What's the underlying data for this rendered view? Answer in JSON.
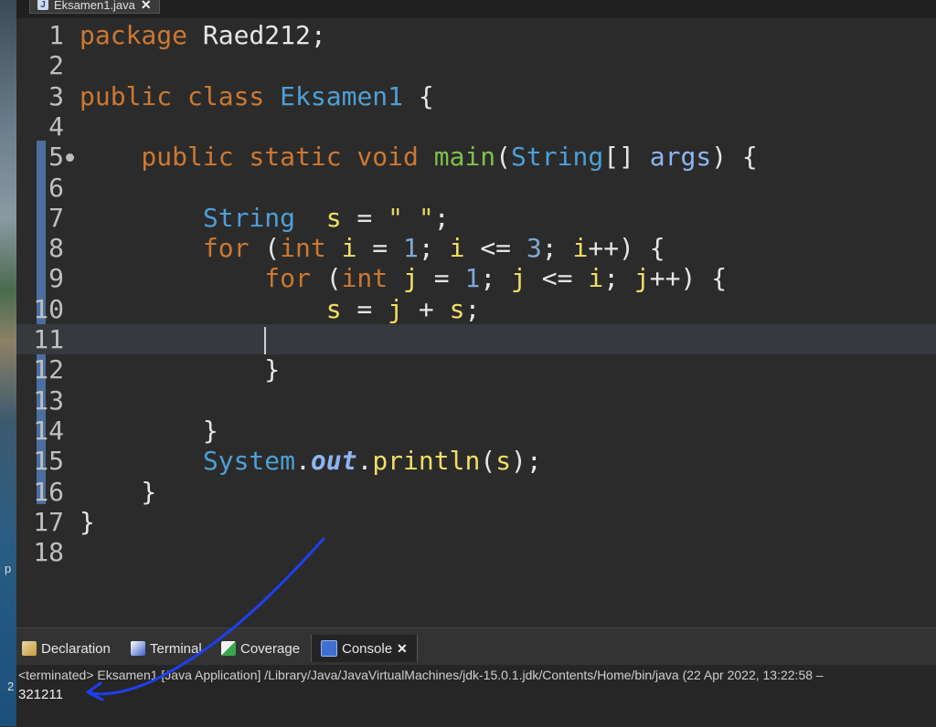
{
  "editor_tab": {
    "icon": "J",
    "title": "Eksamen1.java",
    "close": "✕"
  },
  "desktop": {
    "letter_p": "p",
    "digit_2": "2"
  },
  "code_lines": [
    {
      "n": "1",
      "tokens": [
        [
          "kw",
          "package "
        ],
        [
          "pn",
          "Raed212;"
        ]
      ]
    },
    {
      "n": "2",
      "tokens": []
    },
    {
      "n": "3",
      "tokens": [
        [
          "kw",
          "public class "
        ],
        [
          "ty",
          "Eksamen1"
        ],
        [
          "pn",
          " {"
        ]
      ]
    },
    {
      "n": "4",
      "tokens": []
    },
    {
      "n": "5",
      "tokens": [
        [
          "kw",
          "    public static void "
        ],
        [
          "mt",
          "main"
        ],
        [
          "pn",
          "("
        ],
        [
          "ty",
          "String"
        ],
        [
          "pn",
          "[] "
        ],
        [
          "pv",
          "args"
        ],
        [
          "pn",
          ") {"
        ]
      ],
      "marker": true
    },
    {
      "n": "6",
      "tokens": []
    },
    {
      "n": "7",
      "tokens": [
        [
          "ty",
          "        String  "
        ],
        [
          "vr",
          "s"
        ],
        [
          "pn",
          " = "
        ],
        [
          "st",
          "\" \""
        ],
        [
          "pn",
          ";"
        ]
      ]
    },
    {
      "n": "8",
      "tokens": [
        [
          "kw",
          "        for "
        ],
        [
          "pn",
          "("
        ],
        [
          "kw",
          "int "
        ],
        [
          "vr",
          "i"
        ],
        [
          "pn",
          " = "
        ],
        [
          "nm",
          "1"
        ],
        [
          "pn",
          "; "
        ],
        [
          "vr",
          "i"
        ],
        [
          "pn",
          " <= "
        ],
        [
          "nm",
          "3"
        ],
        [
          "pn",
          "; "
        ],
        [
          "vr",
          "i"
        ],
        [
          "pn",
          "++) {"
        ]
      ]
    },
    {
      "n": "9",
      "tokens": [
        [
          "kw",
          "            for "
        ],
        [
          "pn",
          "("
        ],
        [
          "kw",
          "int "
        ],
        [
          "vr",
          "j"
        ],
        [
          "pn",
          " = "
        ],
        [
          "nm",
          "1"
        ],
        [
          "pn",
          "; "
        ],
        [
          "vr",
          "j"
        ],
        [
          "pn",
          " <= "
        ],
        [
          "vr",
          "i"
        ],
        [
          "pn",
          "; "
        ],
        [
          "vr",
          "j"
        ],
        [
          "pn",
          "++) {"
        ]
      ]
    },
    {
      "n": "10",
      "tokens": [
        [
          "pn",
          "                "
        ],
        [
          "vr",
          "s"
        ],
        [
          "pn",
          " = "
        ],
        [
          "vr",
          "j"
        ],
        [
          "pn",
          " + "
        ],
        [
          "vr",
          "s"
        ],
        [
          "pn",
          ";"
        ]
      ]
    },
    {
      "n": "11",
      "tokens": [
        [
          "pn",
          "            "
        ]
      ],
      "current": true
    },
    {
      "n": "12",
      "tokens": [
        [
          "pn",
          "            }"
        ]
      ]
    },
    {
      "n": "13",
      "tokens": []
    },
    {
      "n": "14",
      "tokens": [
        [
          "pn",
          "        }"
        ]
      ]
    },
    {
      "n": "15",
      "tokens": [
        [
          "ty",
          "        System"
        ],
        [
          "pn",
          "."
        ],
        [
          "fd",
          "out"
        ],
        [
          "pn",
          "."
        ],
        [
          "vr",
          "println"
        ],
        [
          "pn",
          "("
        ],
        [
          "vr",
          "s"
        ],
        [
          "pn",
          ");"
        ]
      ]
    },
    {
      "n": "16",
      "tokens": [
        [
          "pn",
          "    }"
        ]
      ]
    },
    {
      "n": "17",
      "tokens": [
        [
          "pn",
          "}"
        ]
      ]
    },
    {
      "n": "18",
      "tokens": []
    }
  ],
  "panel_tabs": [
    {
      "label": "Declaration",
      "icon": "declaration-icon"
    },
    {
      "label": "Terminal",
      "icon": "terminal-icon"
    },
    {
      "label": "Coverage",
      "icon": "coverage-icon"
    },
    {
      "label": "Console",
      "icon": "console-icon",
      "active": true,
      "close": "✕"
    }
  ],
  "console": {
    "status": "<terminated> Eksamen1 [Java Application] /Library/Java/JavaVirtualMachines/jdk-15.0.1.jdk/Contents/Home/bin/java  (22 Apr 2022, 13:22:58 –",
    "output": "321211"
  },
  "colors": {
    "annotation_arrow": "#1f3ff0"
  }
}
